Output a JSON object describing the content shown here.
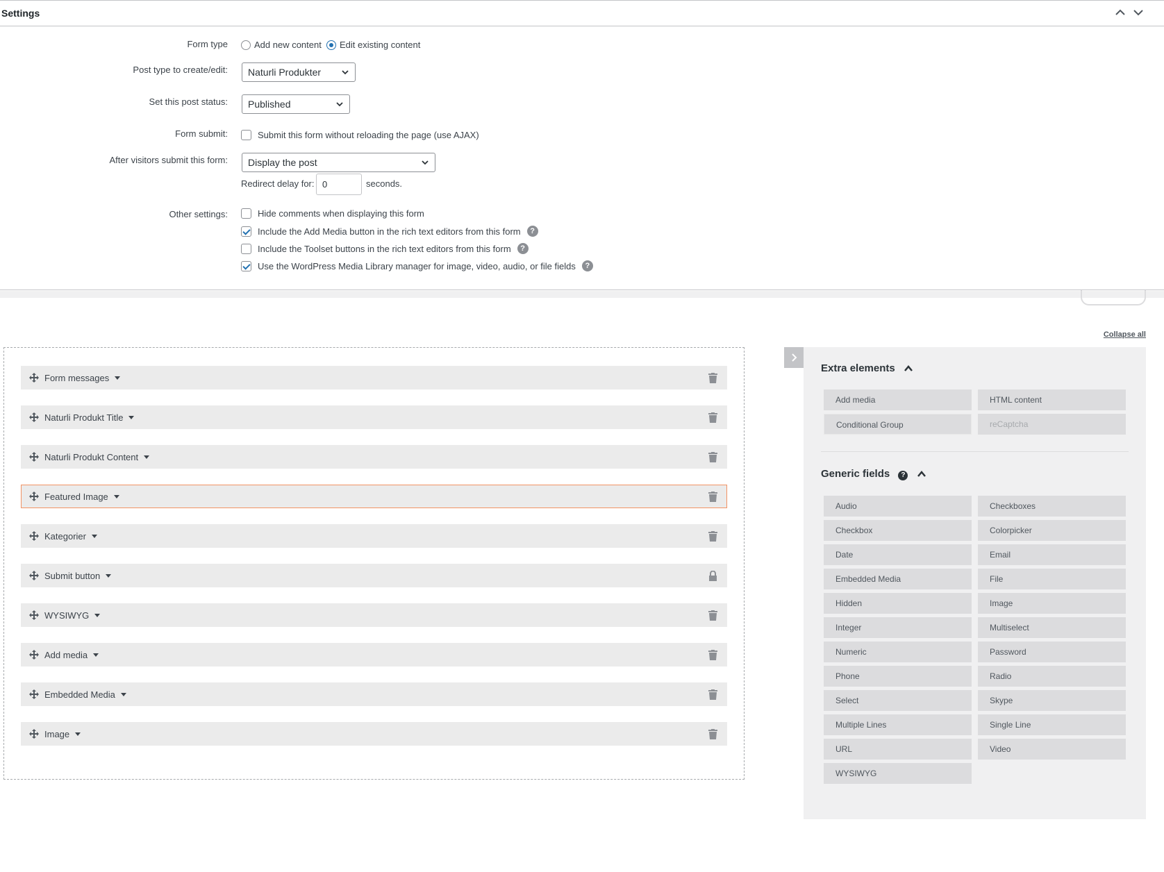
{
  "settings": {
    "title": "Settings",
    "form_type": {
      "label": "Form type",
      "opt_add": "Add new content",
      "opt_edit": "Edit existing content",
      "selected": "Edit existing content"
    },
    "post_type": {
      "label": "Post type to create/edit:",
      "value": "Naturli Produkter"
    },
    "post_status": {
      "label": "Set this post status:",
      "value": "Published"
    },
    "form_submit": {
      "label": "Form submit:",
      "checkbox": "Submit this form without reloading the page (use AJAX)",
      "checked": false
    },
    "after_submit": {
      "label": "After visitors submit this form:",
      "value": "Display the post"
    },
    "redirect": {
      "label": "Redirect delay for:",
      "value": "0",
      "suffix": "seconds."
    },
    "other": {
      "label": "Other settings:",
      "items": [
        {
          "text": "Hide comments when displaying this form",
          "checked": false,
          "help": false
        },
        {
          "text": "Include the Add Media button in the rich text editors from this form",
          "checked": true,
          "help": true
        },
        {
          "text": "Include the Toolset buttons in the rich text editors from this form",
          "checked": false,
          "help": true
        },
        {
          "text": "Use the WordPress Media Library manager for image, video, audio, or file fields",
          "checked": true,
          "help": true
        }
      ]
    }
  },
  "builder": {
    "collapse_all": "Collapse all",
    "fields": [
      {
        "name": "Form messages",
        "action": "trash"
      },
      {
        "name": "Naturli Produkt Title",
        "action": "trash"
      },
      {
        "name": "Naturli Produkt Content",
        "action": "trash"
      },
      {
        "name": "Featured Image",
        "action": "trash",
        "active": true
      },
      {
        "name": "Kategorier",
        "action": "trash"
      },
      {
        "name": "Submit button",
        "action": "lock"
      },
      {
        "name": "WYSIWYG",
        "action": "trash"
      },
      {
        "name": "Add media",
        "action": "trash"
      },
      {
        "name": "Embedded Media",
        "action": "trash"
      },
      {
        "name": "Image",
        "action": "trash"
      }
    ]
  },
  "sidebar": {
    "extra_title": "Extra elements",
    "extra_items": [
      "Add media",
      "HTML content",
      "Conditional Group",
      "reCaptcha"
    ],
    "generic_title": "Generic fields",
    "generic_items": [
      "Audio",
      "Checkboxes",
      "Checkbox",
      "Colorpicker",
      "Date",
      "Email",
      "Embedded Media",
      "File",
      "Hidden",
      "Image",
      "Integer",
      "Multiselect",
      "Numeric",
      "Password",
      "Phone",
      "Radio",
      "Select",
      "Skype",
      "Multiple Lines",
      "Single Line",
      "URL",
      "Video",
      "WYSIWYG"
    ]
  },
  "colors": {
    "accent": "#2271b1",
    "active_border": "#f29263",
    "row_bg": "#ebebeb",
    "tile_bg": "#dcdcde"
  }
}
